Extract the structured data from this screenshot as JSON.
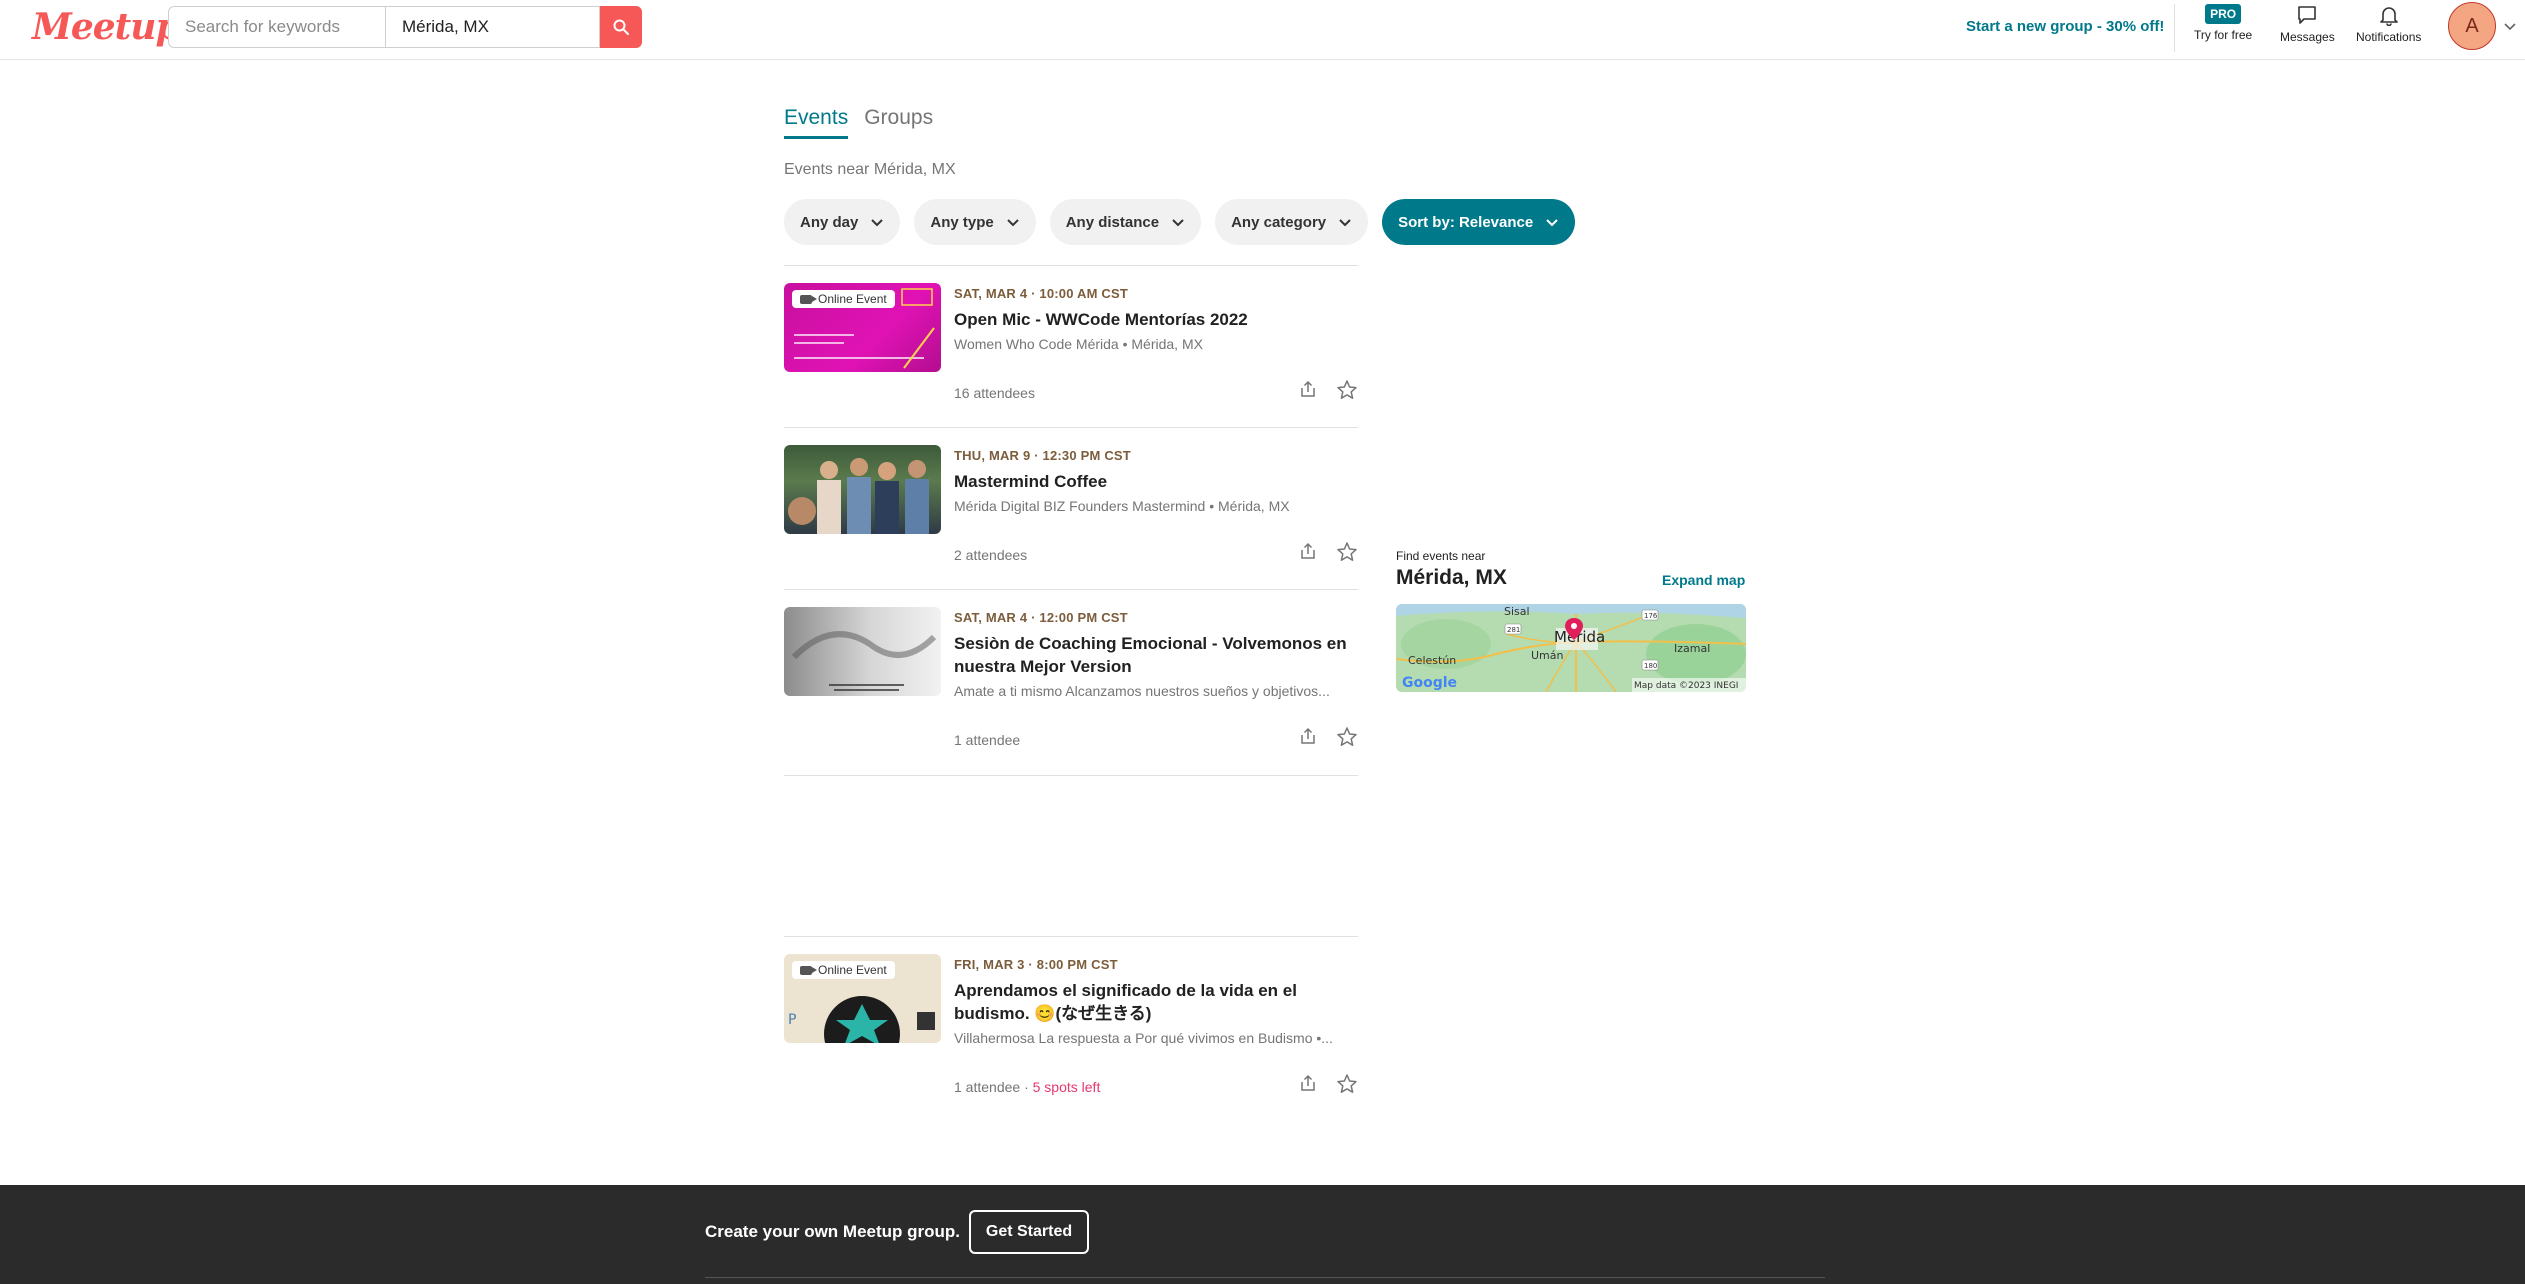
{
  "header": {
    "logo": "Meetup",
    "search_placeholder": "Search for keywords",
    "location_value": "Mérida, MX",
    "promo": "Start a new group - 30% off!",
    "pro_badge": "PRO",
    "try_free": "Try for free",
    "messages": "Messages",
    "notifications": "Notifications",
    "avatar_initial": "A"
  },
  "tabs": [
    {
      "label": "Events",
      "active": true
    },
    {
      "label": "Groups",
      "active": false
    }
  ],
  "events_near": "Events near Mérida, MX",
  "filters": [
    "Any day",
    "Any type",
    "Any distance",
    "Any category"
  ],
  "sort_label": "Sort by: Relevance",
  "events": [
    {
      "online_badge": "Online Event",
      "date": "SAT, MAR 4 · 10:00 AM CST",
      "title": "Open Mic - WWCode Mentorías 2022",
      "group": "Women Who Code Mérida • Mérida, MX",
      "attendees": "16 attendees"
    },
    {
      "date": "THU, MAR 9 · 12:30 PM CST",
      "title": "Mastermind Coffee",
      "group": "Mérida Digital BIZ Founders Mastermind • Mérida, MX",
      "attendees": "2 attendees"
    },
    {
      "date": "SAT, MAR 4 · 12:00 PM CST",
      "title": "Sesiòn de Coaching Emocional - Volvemonos en nuestra Mejor Version",
      "group": "Amate a ti mismo Alcanzamos nuestros sueños y objetivos...",
      "attendees": "1 attendee"
    },
    {
      "online_badge": "Online Event",
      "date": "FRI, MAR 3 · 8:00 PM CST",
      "title": "Aprendamos el significado de la vida en el budismo. 😊(なぜ生きる)",
      "group": "Villahermosa La respuesta a Por qué vivimos en Budismo •...",
      "attendees": "1 attendee",
      "spots": "5 spots left"
    }
  ],
  "map": {
    "find_label": "Find events near",
    "city": "Mérida, MX",
    "expand": "Expand map",
    "places": [
      "Sisal",
      "Mérida",
      "Umán",
      "Celestún",
      "Izamal"
    ],
    "roads": [
      "281",
      "176",
      "180"
    ],
    "attribution": "Map data ©2023 INEGI",
    "provider": "Google"
  },
  "footer": {
    "cta": "Create your own Meetup group.",
    "button": "Get Started"
  },
  "colors": {
    "brand": "#f65858",
    "accent": "#00798a",
    "date": "#7c5c3b",
    "spots": "#e5386d"
  }
}
